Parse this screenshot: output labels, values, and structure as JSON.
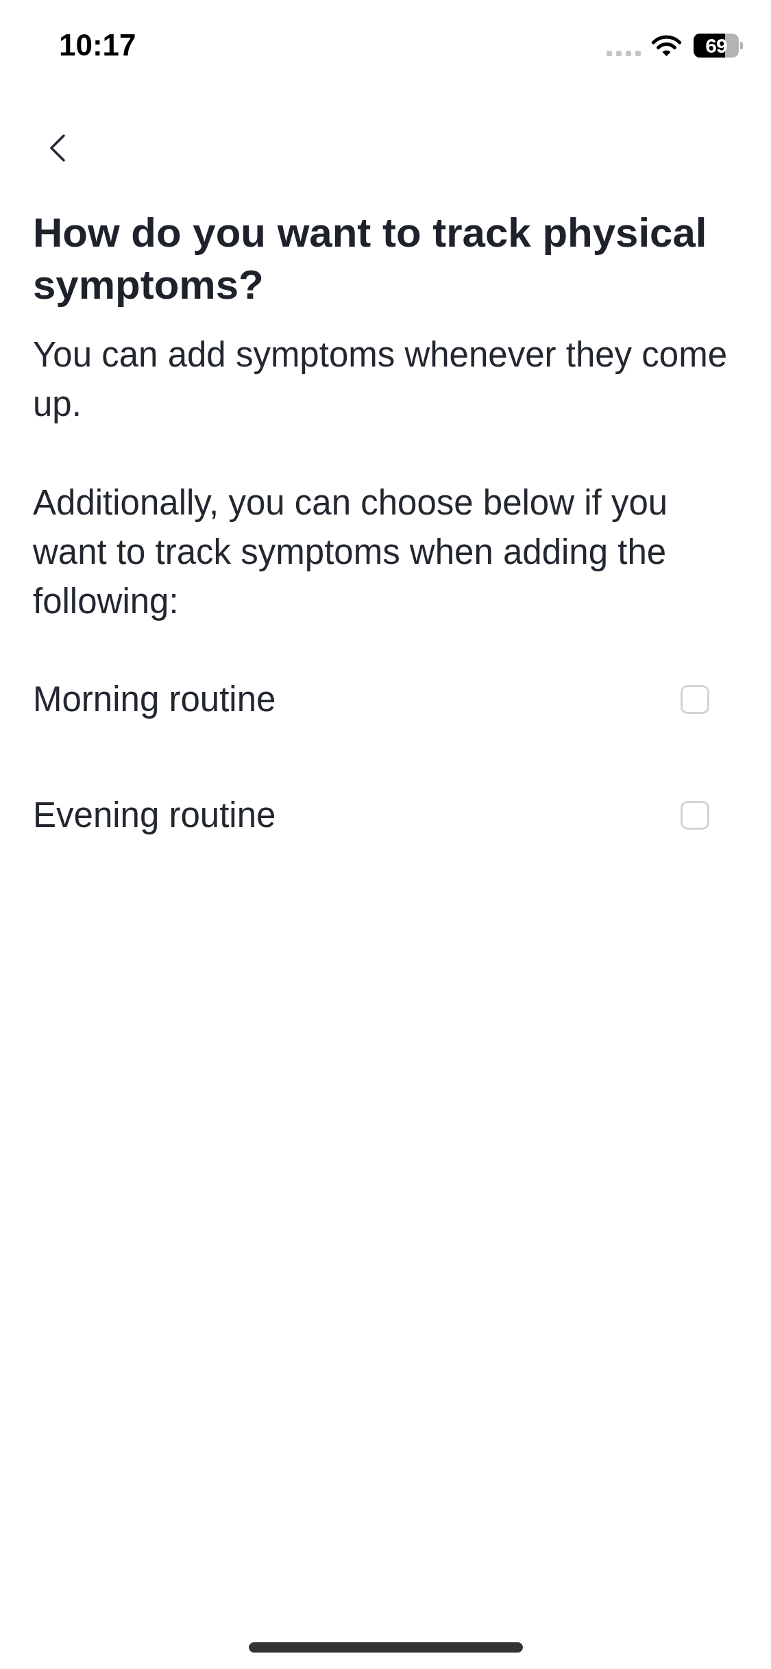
{
  "status_bar": {
    "time": "10:17",
    "battery": "69"
  },
  "title": "How do you want to track physical symptoms?",
  "paragraphs": [
    "You can add symptoms whenever they come up.",
    "Additionally, you can choose below if you want to track symptoms when adding the following:"
  ],
  "options": [
    {
      "label": "Morning routine",
      "checked": false
    },
    {
      "label": "Evening routine",
      "checked": false
    }
  ]
}
